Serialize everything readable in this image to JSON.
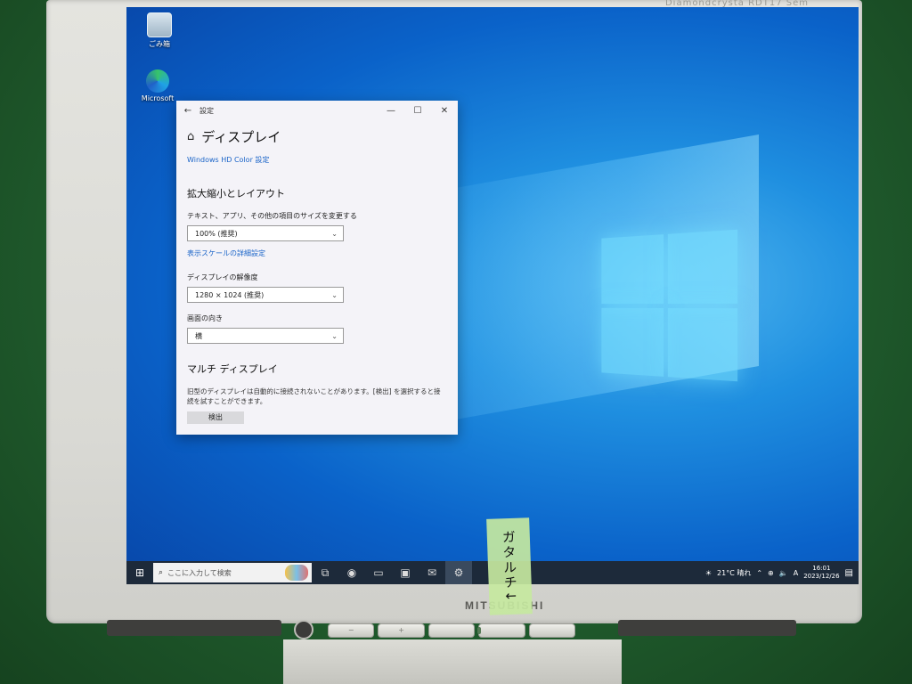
{
  "monitor": {
    "brand": "MITSUBISHI",
    "top_text": "Diamondcrysta RDT17 Sem"
  },
  "desktop": {
    "icons": [
      {
        "label": "ごみ箱",
        "icon": "recycle-bin-icon"
      },
      {
        "label": "Microsoft",
        "icon": "edge-icon"
      }
    ]
  },
  "settings_window": {
    "app_title": "設定",
    "page_title": "ディスプレイ",
    "hd_color_link": "Windows HD Color 設定",
    "scale_section": "拡大縮小とレイアウト",
    "scale_label": "テキスト、アプリ、その他の項目のサイズを変更する",
    "scale_value": "100% (推奨)",
    "advanced_scale_link": "表示スケールの詳細設定",
    "resolution_label": "ディスプレイの解像度",
    "resolution_value": "1280 × 1024 (推奨)",
    "orientation_label": "画面の向き",
    "orientation_value": "横",
    "multi_section": "マルチ ディスプレイ",
    "multi_note": "旧型のディスプレイは自動的に接続されないことがあります。[検出] を選択すると接続を試すことができます。",
    "detect_button": "検出"
  },
  "taskbar": {
    "search_placeholder": "ここに入力して検索",
    "weather": "21°C 晴れ",
    "time": "16:01",
    "date": "2023/12/26"
  },
  "tape_note": "ガタルチ↓"
}
